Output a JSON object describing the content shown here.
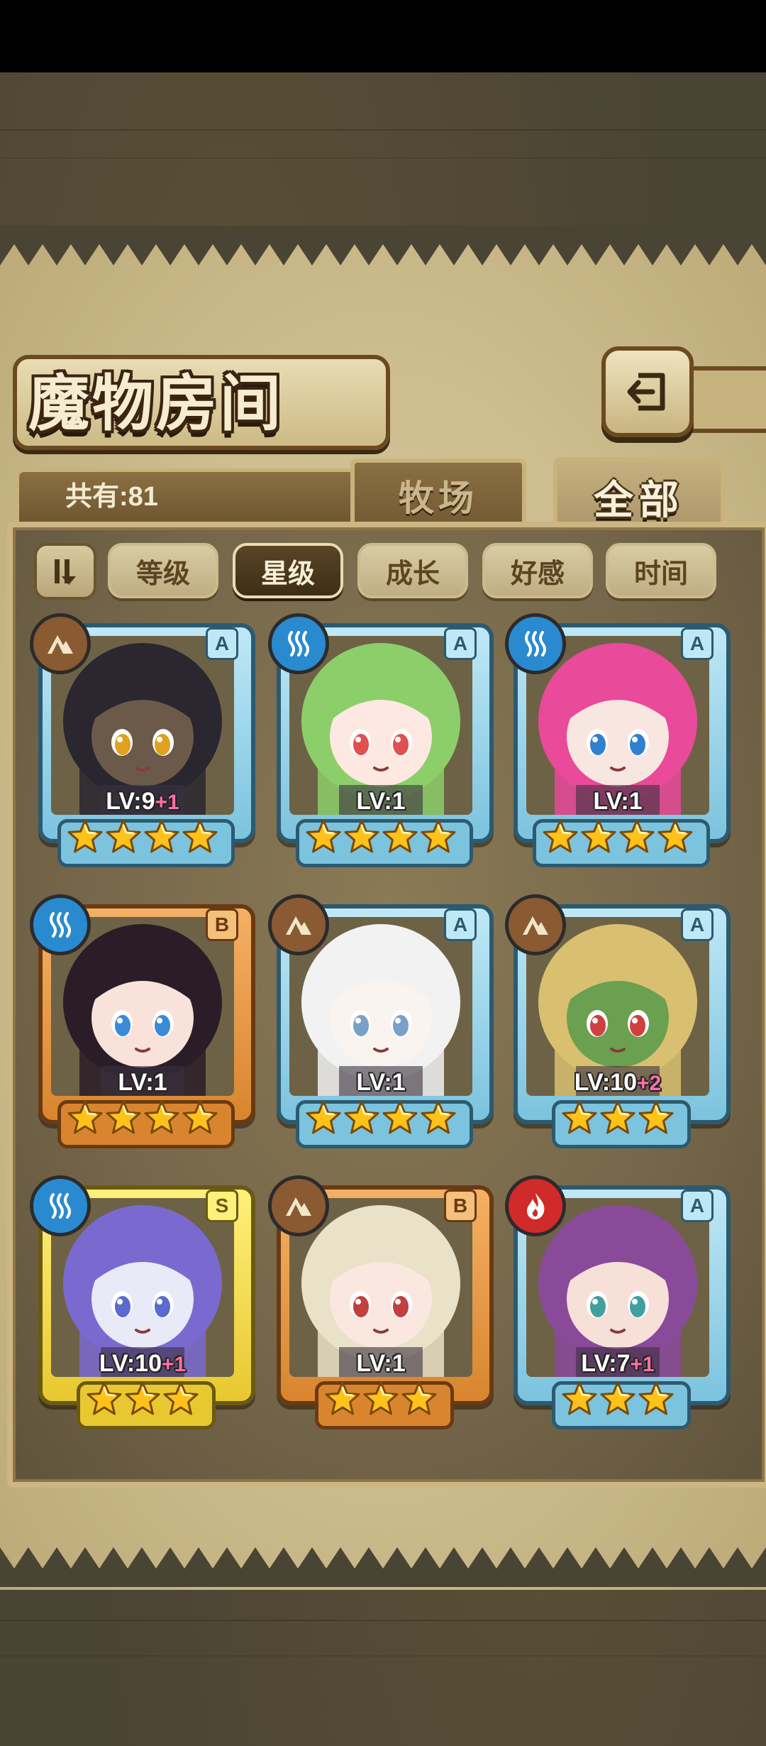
{
  "header": {
    "title": "魔物房间",
    "total_label": "共有:81"
  },
  "tabs": [
    {
      "label": "牧场",
      "selected": false
    },
    {
      "label": "全部",
      "selected": true
    }
  ],
  "filters": [
    {
      "label": "等级",
      "selected": false
    },
    {
      "label": "星级",
      "selected": true
    },
    {
      "label": "成长",
      "selected": false
    },
    {
      "label": "好感",
      "selected": false
    },
    {
      "label": "时间",
      "selected": false
    }
  ],
  "monsters": [
    {
      "level": "LV:9",
      "bonus": "+1",
      "rank": "A",
      "element": "earth",
      "stars": 4,
      "frame": "blue",
      "hair": "#2a2730",
      "skin": "#6b5a4a",
      "eye": "#e0a020"
    },
    {
      "level": "LV:1",
      "bonus": "",
      "rank": "A",
      "element": "water",
      "stars": 4,
      "frame": "blue",
      "hair": "#8ccf6a",
      "skin": "#fde8e2",
      "eye": "#e05050"
    },
    {
      "level": "LV:1",
      "bonus": "",
      "rank": "A",
      "element": "water",
      "stars": 4,
      "frame": "blue",
      "hair": "#e94a9a",
      "skin": "#f8e6e0",
      "eye": "#3080d0"
    },
    {
      "level": "LV:1",
      "bonus": "",
      "rank": "B",
      "element": "water",
      "stars": 4,
      "frame": "orange",
      "hair": "#2a1d28",
      "skin": "#f8e2da",
      "eye": "#3a8ad8"
    },
    {
      "level": "LV:1",
      "bonus": "",
      "rank": "A",
      "element": "earth",
      "stars": 4,
      "frame": "blue",
      "hair": "#f2f2f2",
      "skin": "#faf4f0",
      "eye": "#7aa0c8"
    },
    {
      "level": "LV:10",
      "bonus": "+2",
      "rank": "A",
      "element": "earth",
      "stars": 3,
      "frame": "blue",
      "hair": "#d8c070",
      "skin": "#6aa050",
      "eye": "#d04040"
    },
    {
      "level": "LV:10",
      "bonus": "+1",
      "rank": "S",
      "element": "water",
      "stars": 3,
      "frame": "gold",
      "hair": "#7a6ad0",
      "skin": "#e8eaf8",
      "eye": "#5a6ad0"
    },
    {
      "level": "LV:1",
      "bonus": "",
      "rank": "B",
      "element": "earth",
      "stars": 3,
      "frame": "orange",
      "hair": "#eae2c8",
      "skin": "#fae8e0",
      "eye": "#c04040"
    },
    {
      "level": "LV:7",
      "bonus": "+1",
      "rank": "A",
      "element": "fire",
      "stars": 3,
      "frame": "blue",
      "hair": "#8a4a9a",
      "skin": "#f6e0d8",
      "eye": "#40a0a0"
    }
  ],
  "colors": {
    "element_earth": "#8a5a32",
    "element_water": "#2a8ad0",
    "element_fire": "#d02a2a",
    "star": "#ffc21a"
  }
}
